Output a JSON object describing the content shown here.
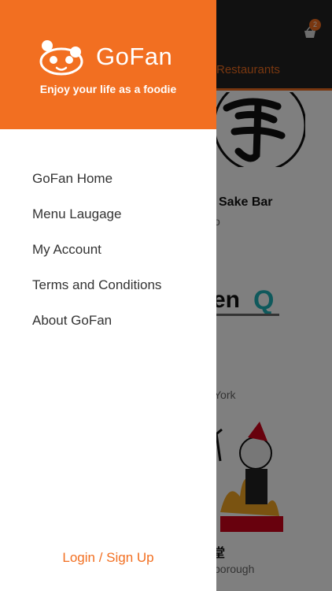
{
  "colors": {
    "accent": "#f26f21",
    "header_dark": "#222222"
  },
  "background": {
    "cart_badge": "2",
    "tab_label": "Restaurants",
    "restaurants": [
      {
        "name": "Sake Bar",
        "location": "o"
      },
      {
        "name": "",
        "location": "York"
      },
      {
        "name": "堂",
        "location": "borough"
      }
    ]
  },
  "drawer": {
    "brand": "GoFan",
    "tagline": "Enjoy your life as a foodie",
    "menu": [
      {
        "label": "GoFan Home"
      },
      {
        "label": "Menu Laugage"
      },
      {
        "label": "My Account"
      },
      {
        "label": "Terms and Conditions"
      },
      {
        "label": "About GoFan"
      }
    ],
    "login_label": "Login / Sign Up"
  }
}
